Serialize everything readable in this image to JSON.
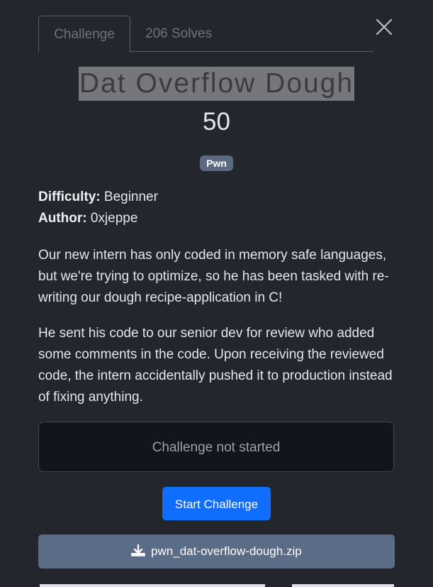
{
  "tabs": [
    {
      "label": "Challenge",
      "active": true
    },
    {
      "label": "206 Solves",
      "active": false
    }
  ],
  "challenge": {
    "title": "Dat Overflow Dough",
    "points": "50",
    "category": "Pwn",
    "difficulty_label": "Difficulty:",
    "difficulty_value": "Beginner",
    "author_label": "Author:",
    "author_value": "0xjeppe",
    "description": [
      "Our new intern has only coded in memory safe languages, but we're trying to optimize, so he has been tasked with re-writing our dough recipe-application in C!",
      "He sent his code to our senior dev for review who added some comments in the code. Upon receiving the reviewed code, the intern accidentally pushed it to production instead of fixing anything."
    ]
  },
  "status": {
    "text": "Challenge not started"
  },
  "actions": {
    "start_label": "Start Challenge",
    "download_label": "pwn_dat-overflow-dough.zip"
  },
  "icons": {
    "close": "close-icon",
    "download": "download-icon"
  },
  "colors": {
    "background": "#23262d",
    "primary": "#0f6efd",
    "download_bg": "#5b6c86",
    "badge_bg": "#5b6a80",
    "status_bg": "#12151b"
  }
}
